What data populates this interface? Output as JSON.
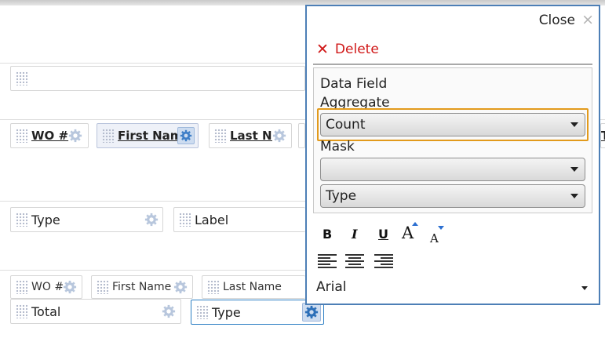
{
  "layout_rows": {
    "row1": [],
    "row2": [
      {
        "label": "WO #"
      },
      {
        "label": "First Name"
      },
      {
        "label": "Last Na"
      },
      {
        "label": "T"
      }
    ],
    "row3": [
      {
        "label": "Type"
      },
      {
        "label": "Label"
      }
    ],
    "row4": [
      {
        "label": "WO #"
      },
      {
        "label": "First Name"
      },
      {
        "label": "Last Name"
      }
    ],
    "row5": [
      {
        "label": "Total"
      },
      {
        "label": "Type"
      }
    ]
  },
  "panel": {
    "close_label": "Close",
    "close_icon": "×",
    "delete_icon": "✕",
    "delete_label": "Delete",
    "data_field_label": "Data Field",
    "aggregate_label": "Aggregate",
    "aggregate_value": "Count",
    "mask_label": "Mask",
    "mask_value": "",
    "type_value": "Type",
    "bold": "B",
    "italic": "I",
    "underline": "U",
    "font_grow": "A",
    "font_shrink": "A",
    "font_family": "Arial"
  },
  "colors": {
    "delete": "#d01818",
    "panel_border": "#4d7fb6",
    "focus": "#e29a1c",
    "font_size_arrows": "#2c6fd1"
  }
}
